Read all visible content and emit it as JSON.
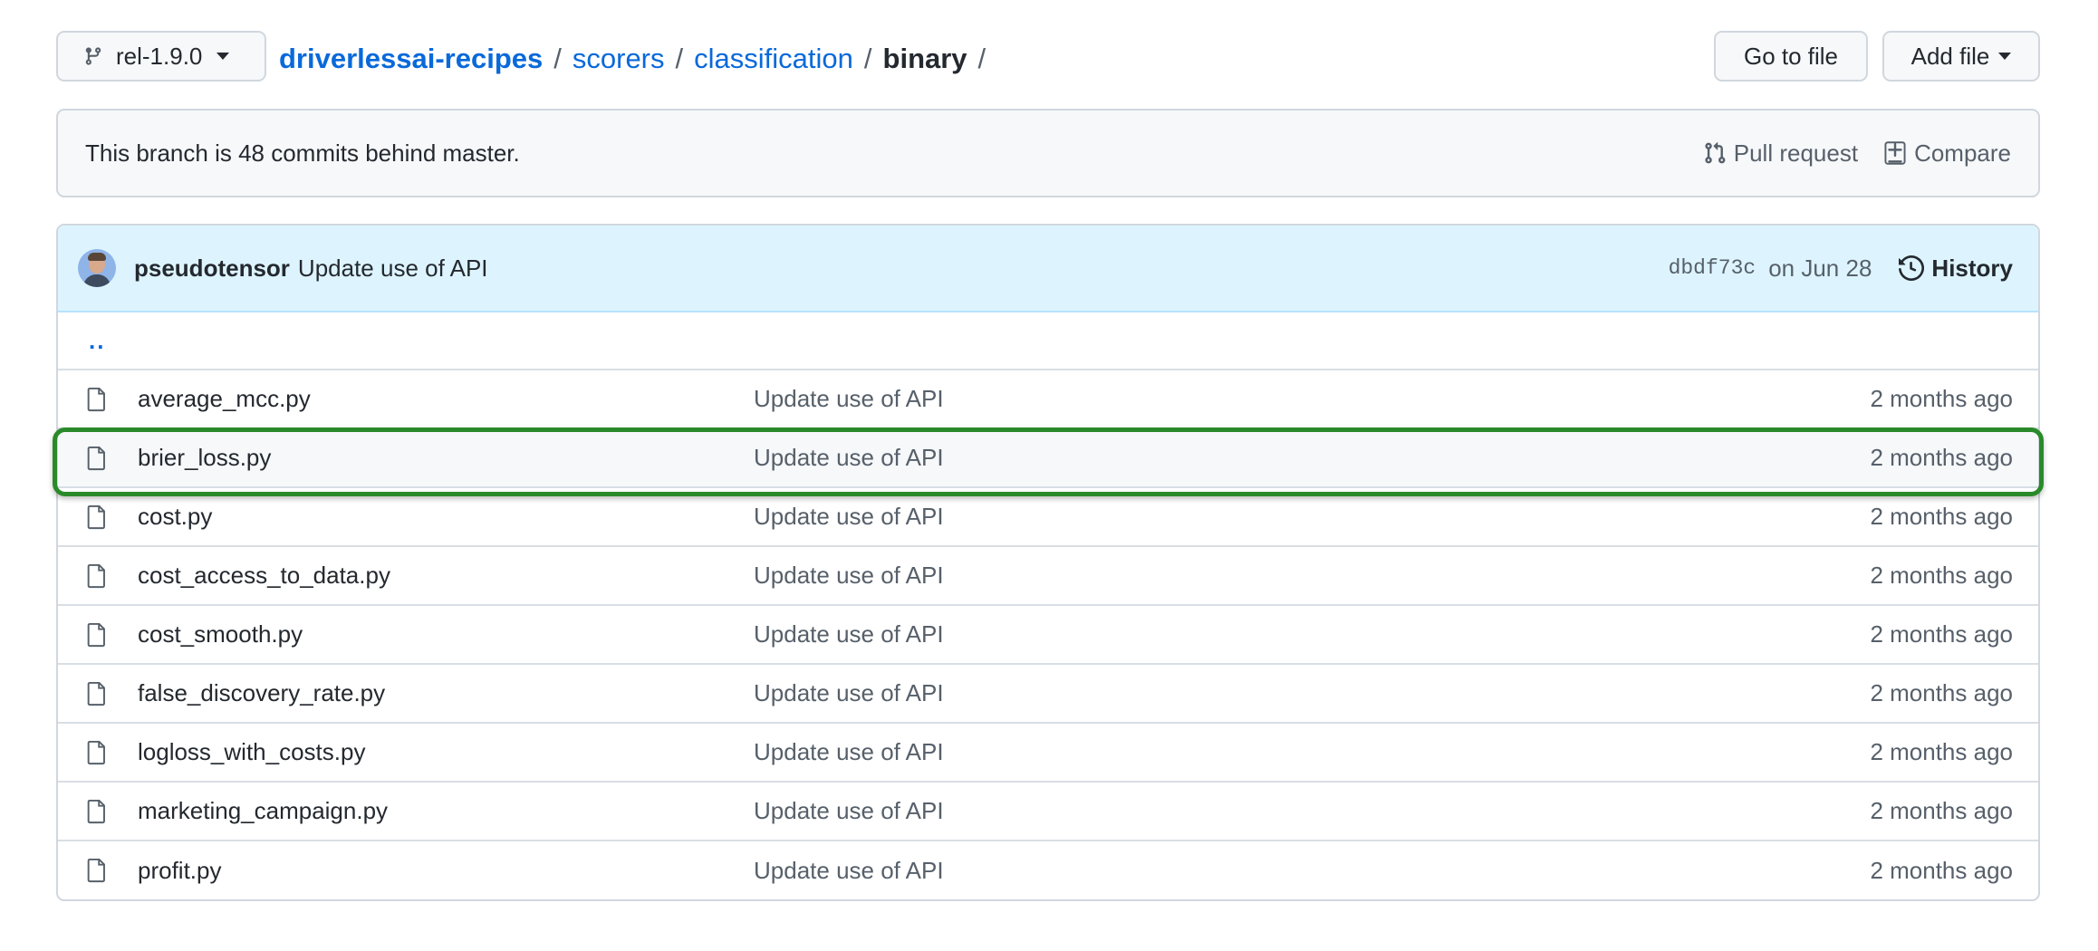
{
  "branch": {
    "name": "rel-1.9.0"
  },
  "breadcrumb": {
    "repo": "driverlessai-recipes",
    "parts": [
      "scorers",
      "classification"
    ],
    "current": "binary",
    "separator": "/"
  },
  "toolbar": {
    "goto_label": "Go to file",
    "add_label": "Add file"
  },
  "branch_info": {
    "message": "This branch is 48 commits behind master.",
    "pull_request_label": "Pull request",
    "compare_label": "Compare"
  },
  "commit": {
    "author": "pseudotensor",
    "message": "Update use of API",
    "sha": "dbdf73c",
    "date": "on Jun 28",
    "history_label": "History"
  },
  "parent_link": "..",
  "files": [
    {
      "name": "average_mcc.py",
      "message": "Update use of API",
      "age": "2 months ago"
    },
    {
      "name": "brier_loss.py",
      "message": "Update use of API",
      "age": "2 months ago"
    },
    {
      "name": "cost.py",
      "message": "Update use of API",
      "age": "2 months ago"
    },
    {
      "name": "cost_access_to_data.py",
      "message": "Update use of API",
      "age": "2 months ago"
    },
    {
      "name": "cost_smooth.py",
      "message": "Update use of API",
      "age": "2 months ago"
    },
    {
      "name": "false_discovery_rate.py",
      "message": "Update use of API",
      "age": "2 months ago"
    },
    {
      "name": "logloss_with_costs.py",
      "message": "Update use of API",
      "age": "2 months ago"
    },
    {
      "name": "marketing_campaign.py",
      "message": "Update use of API",
      "age": "2 months ago"
    },
    {
      "name": "profit.py",
      "message": "Update use of API",
      "age": "2 months ago"
    }
  ],
  "highlighted_file": "brier_loss.py",
  "colors": {
    "link": "#0969da",
    "highlight": "#2a8a2a",
    "commit_bar": "#ddf4ff"
  }
}
